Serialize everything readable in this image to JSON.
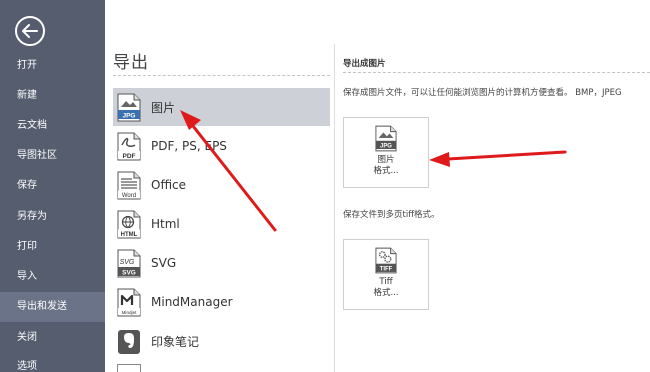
{
  "sidebar": {
    "items": [
      {
        "label": "打开"
      },
      {
        "label": "新建"
      },
      {
        "label": "云文档"
      },
      {
        "label": "导图社区"
      },
      {
        "label": "保存"
      },
      {
        "label": "另存为"
      },
      {
        "label": "打印"
      },
      {
        "label": "导入"
      },
      {
        "label": "导出和发送"
      },
      {
        "label": "关闭"
      },
      {
        "label": "选项"
      }
    ],
    "active_index": 8
  },
  "main": {
    "title": "导出",
    "export_items": [
      {
        "label": "图片",
        "icon": "jpg-file-icon",
        "badge": "JPG"
      },
      {
        "label": "PDF, PS, EPS",
        "icon": "pdf-file-icon",
        "badge": "PDF"
      },
      {
        "label": "Office",
        "icon": "word-file-icon",
        "badge": "Word"
      },
      {
        "label": "Html",
        "icon": "html-file-icon",
        "badge": "HTML"
      },
      {
        "label": "SVG",
        "icon": "svg-file-icon",
        "badge": "SVG"
      },
      {
        "label": "MindManager",
        "icon": "mindjet-file-icon",
        "badge": "Mindjet"
      },
      {
        "label": "印象笔记",
        "icon": "evernote-icon",
        "badge": ""
      }
    ],
    "selected_index": 0
  },
  "panel": {
    "heading": "导出成图片",
    "desc1": "保存成图片文件，可以让任何能浏览图片的计算机方便查看。 BMP，JPEG",
    "button1": {
      "badge": "JPG",
      "line1": "图片",
      "line2": "格式..."
    },
    "desc2": "保存文件到多页tiff格式。",
    "button2": {
      "badge": "TIFF",
      "line1": "Tiff",
      "line2": "格式..."
    }
  },
  "colors": {
    "sidebar_bg": "#555d6f",
    "sidebar_active": "#6b7388",
    "selected_bg": "#cdd0d6",
    "annotation_arrow": "#e0191b"
  }
}
